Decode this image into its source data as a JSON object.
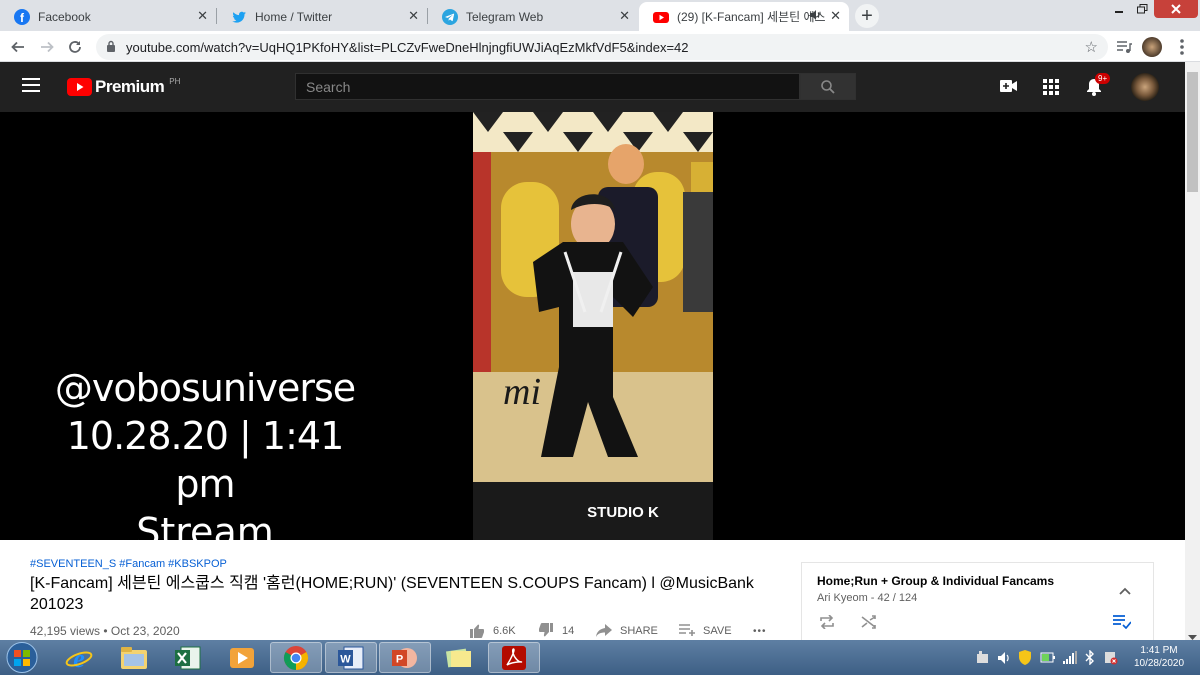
{
  "browser": {
    "tabs": [
      {
        "label": "Facebook",
        "icon": "facebook-icon",
        "active": false
      },
      {
        "label": "Home / Twitter",
        "icon": "twitter-icon",
        "active": false
      },
      {
        "label": "Telegram Web",
        "icon": "telegram-icon",
        "active": false
      },
      {
        "label": "(29) [K-Fancam] 세븐틴 에스",
        "icon": "youtube-icon",
        "active": true
      }
    ],
    "tab_close": "✕",
    "new_tab": "+",
    "url": "youtube.com/watch?v=UqHQ1PKfoHY&list=PLCZvFweDneHlnjngfiUWJiAqEzMkfVdF5&index=42"
  },
  "youtube": {
    "logo_text": "Premium",
    "region": "PH",
    "search_placeholder": "Search",
    "notification_count": "9+",
    "overlay_lines": [
      "@vobosuniverse",
      "10.28.20 | 1:41 pm",
      "Stream"
    ],
    "video_watermark_1": "mi",
    "video_watermark_2": "STUDIO K",
    "hashtags": "#SEVENTEEN_S #Fancam #KBSKPOP",
    "title_line1": "[K-Fancam] 세븐틴 에스쿱스 직캠 '홈런(HOME;RUN)' (SEVENTEEN S.COUPS Fancam) l @MusicBank",
    "title_line2": "201023",
    "views_date": "42,195 views • Oct 23, 2020",
    "likes": "6.6K",
    "dislikes": "14",
    "share_label": "SHARE",
    "save_label": "SAVE",
    "more_label": "•••",
    "playlist": {
      "title": "Home;Run + Group & Individual Fancams",
      "subtitle": "Ari Kyeom - 42 / 124"
    }
  },
  "taskbar": {
    "apps": [
      "start-orb",
      "ie-icon",
      "file-explorer-icon",
      "excel-icon",
      "media-player-icon",
      "chrome-icon",
      "word-icon",
      "powerpoint-icon",
      "sticky-notes-icon",
      "acrobat-icon"
    ],
    "time": "1:41 PM",
    "date": "10/28/2020"
  },
  "colors": {
    "youtube_red": "#ff0000",
    "yt_dark": "#212121",
    "link_blue": "#065fd4"
  }
}
